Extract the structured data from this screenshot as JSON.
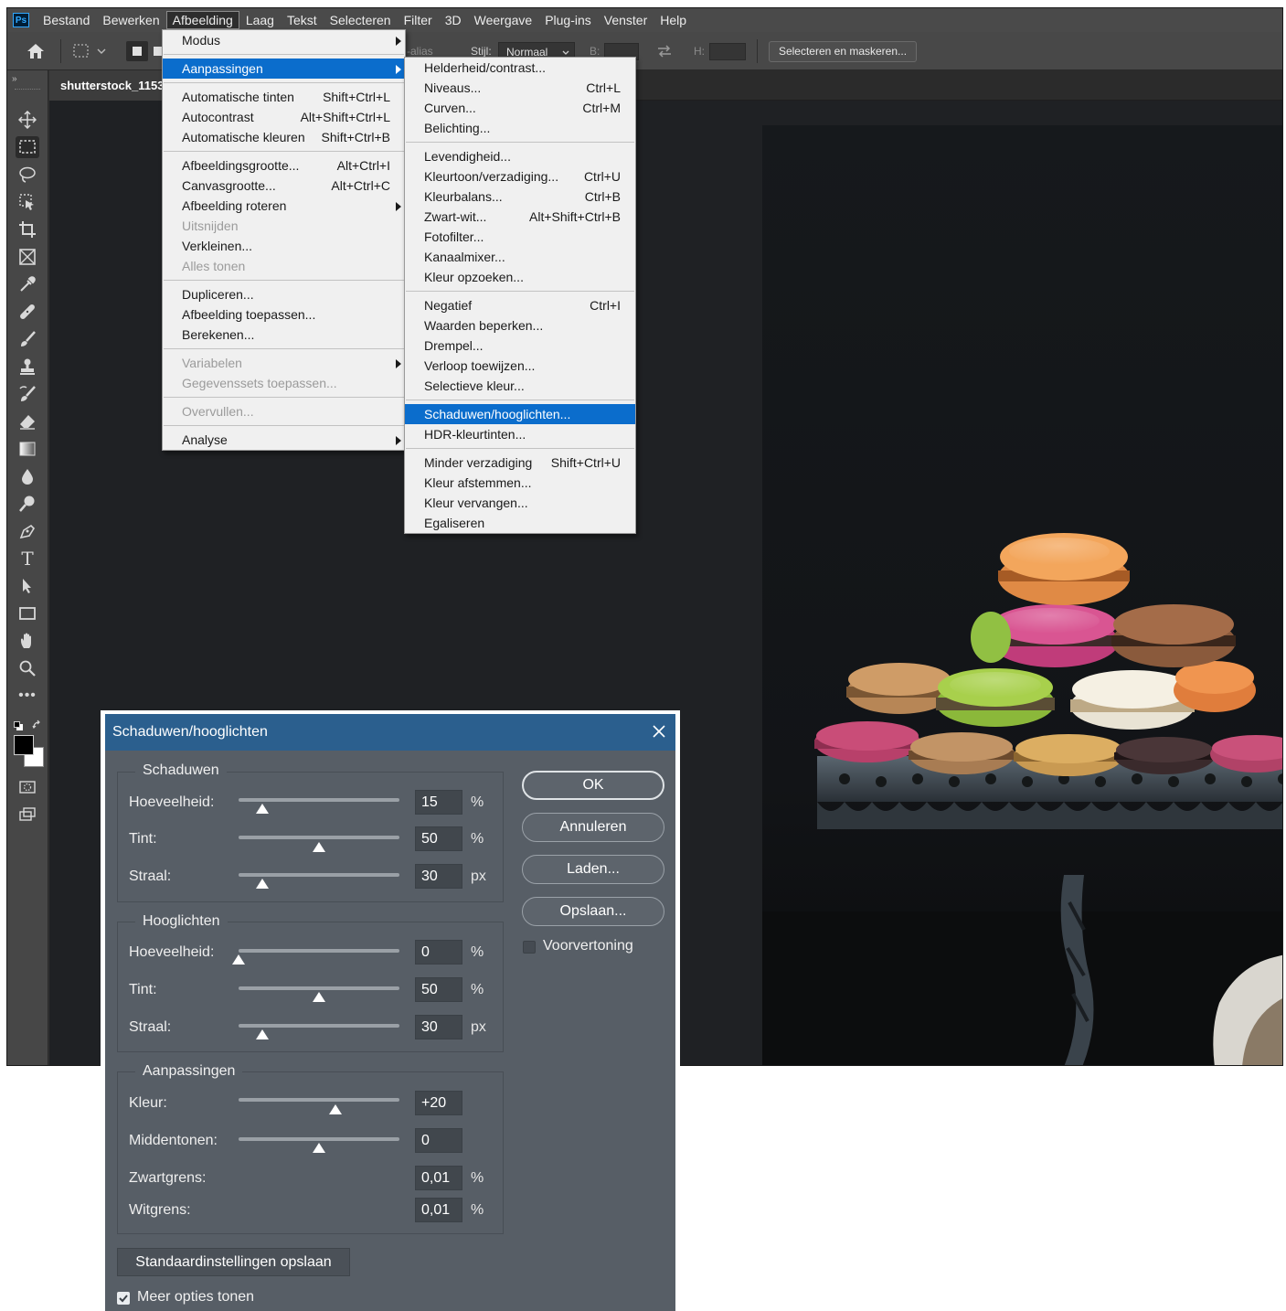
{
  "menubar": {
    "items": [
      "Bestand",
      "Bewerken",
      "Afbeelding",
      "Laag",
      "Tekst",
      "Selecteren",
      "Filter",
      "3D",
      "Weergave",
      "Plug-ins",
      "Venster",
      "Help"
    ],
    "active": "Afbeelding",
    "app_badge": "Ps"
  },
  "options": {
    "anti_alias_partial": "-alias",
    "style_label": "Stijl:",
    "style_value": "Normaal",
    "b_label": "B:",
    "h_label": "H:",
    "select_mask": "Selecteren en maskeren..."
  },
  "document": {
    "tab_title": "shutterstock_1153"
  },
  "image_menu": {
    "items": [
      {
        "label": "Modus",
        "shortcut": "",
        "submenu": true,
        "disabled": false
      },
      {
        "sep": true
      },
      {
        "label": "Aanpassingen",
        "shortcut": "",
        "submenu": true,
        "disabled": false,
        "highlight": true
      },
      {
        "sep": true
      },
      {
        "label": "Automatische tinten",
        "shortcut": "Shift+Ctrl+L"
      },
      {
        "label": "Autocontrast",
        "shortcut": "Alt+Shift+Ctrl+L"
      },
      {
        "label": "Automatische kleuren",
        "shortcut": "Shift+Ctrl+B"
      },
      {
        "sep": true
      },
      {
        "label": "Afbeeldingsgrootte...",
        "shortcut": "Alt+Ctrl+I"
      },
      {
        "label": "Canvasgrootte...",
        "shortcut": "Alt+Ctrl+C"
      },
      {
        "label": "Afbeelding roteren",
        "shortcut": "",
        "submenu": true
      },
      {
        "label": "Uitsnijden",
        "shortcut": "",
        "disabled": true
      },
      {
        "label": "Verkleinen...",
        "shortcut": ""
      },
      {
        "label": "Alles tonen",
        "shortcut": "",
        "disabled": true
      },
      {
        "sep": true
      },
      {
        "label": "Dupliceren...",
        "shortcut": ""
      },
      {
        "label": "Afbeelding toepassen...",
        "shortcut": ""
      },
      {
        "label": "Berekenen...",
        "shortcut": ""
      },
      {
        "sep": true
      },
      {
        "label": "Variabelen",
        "shortcut": "",
        "submenu": true,
        "disabled": true
      },
      {
        "label": "Gegevenssets toepassen...",
        "shortcut": "",
        "disabled": true
      },
      {
        "sep": true
      },
      {
        "label": "Overvullen...",
        "shortcut": "",
        "disabled": true
      },
      {
        "sep": true
      },
      {
        "label": "Analyse",
        "shortcut": "",
        "submenu": true
      }
    ]
  },
  "adjustments_menu": {
    "items": [
      {
        "label": "Helderheid/contrast...",
        "shortcut": ""
      },
      {
        "label": "Niveaus...",
        "shortcut": "Ctrl+L"
      },
      {
        "label": "Curven...",
        "shortcut": "Ctrl+M"
      },
      {
        "label": "Belichting...",
        "shortcut": ""
      },
      {
        "sep": true
      },
      {
        "label": "Levendigheid...",
        "shortcut": ""
      },
      {
        "label": "Kleurtoon/verzadiging...",
        "shortcut": "Ctrl+U"
      },
      {
        "label": "Kleurbalans...",
        "shortcut": "Ctrl+B"
      },
      {
        "label": "Zwart-wit...",
        "shortcut": "Alt+Shift+Ctrl+B"
      },
      {
        "label": "Fotofilter...",
        "shortcut": ""
      },
      {
        "label": "Kanaalmixer...",
        "shortcut": ""
      },
      {
        "label": "Kleur opzoeken...",
        "shortcut": ""
      },
      {
        "sep": true
      },
      {
        "label": "Negatief",
        "shortcut": "Ctrl+I"
      },
      {
        "label": "Waarden beperken...",
        "shortcut": ""
      },
      {
        "label": "Drempel...",
        "shortcut": ""
      },
      {
        "label": "Verloop toewijzen...",
        "shortcut": ""
      },
      {
        "label": "Selectieve kleur...",
        "shortcut": ""
      },
      {
        "sep": true
      },
      {
        "label": "Schaduwen/hooglichten...",
        "shortcut": "",
        "highlight": true
      },
      {
        "label": "HDR-kleurtinten...",
        "shortcut": ""
      },
      {
        "sep": true
      },
      {
        "label": "Minder verzadiging",
        "shortcut": "Shift+Ctrl+U"
      },
      {
        "label": "Kleur afstemmen...",
        "shortcut": ""
      },
      {
        "label": "Kleur vervangen...",
        "shortcut": ""
      },
      {
        "label": "Egaliseren",
        "shortcut": ""
      }
    ]
  },
  "dialog": {
    "title": "Schaduwen/hooglichten",
    "shadows": {
      "title": "Schaduwen",
      "amount_label": "Hoeveelheid:",
      "amount": "15",
      "amount_unit": "%",
      "amount_pos": 0.15,
      "tone_label": "Tint:",
      "tone": "50",
      "tone_unit": "%",
      "tone_pos": 0.5,
      "radius_label": "Straal:",
      "radius": "30",
      "radius_unit": "px",
      "radius_pos": 0.15
    },
    "highlights": {
      "title": "Hooglichten",
      "amount_label": "Hoeveelheid:",
      "amount": "0",
      "amount_unit": "%",
      "amount_pos": 0,
      "tone_label": "Tint:",
      "tone": "50",
      "tone_unit": "%",
      "tone_pos": 0.5,
      "radius_label": "Straal:",
      "radius": "30",
      "radius_unit": "px",
      "radius_pos": 0.15
    },
    "adjustments": {
      "title": "Aanpassingen",
      "color_label": "Kleur:",
      "color": "+20",
      "color_pos": 0.6,
      "midtone_label": "Middentonen:",
      "midtone": "0",
      "midtone_pos": 0.5,
      "black_clip_label": "Zwartgrens:",
      "black_clip": "0,01",
      "black_clip_unit": "%",
      "white_clip_label": "Witgrens:",
      "white_clip": "0,01",
      "white_clip_unit": "%"
    },
    "buttons": {
      "ok": "OK",
      "cancel": "Annuleren",
      "load": "Laden...",
      "save": "Opslaan..."
    },
    "preview_label": "Voorvertoning",
    "preview_checked": false,
    "save_defaults": "Standaardinstellingen opslaan",
    "more_options_label": "Meer opties tonen",
    "more_options_checked": true
  },
  "colors": {
    "menu_highlight": "#0b6dcc",
    "dialog_bg": "#575e66",
    "dialog_titlebar": "#2b5f8e",
    "workspace": "#323232"
  }
}
